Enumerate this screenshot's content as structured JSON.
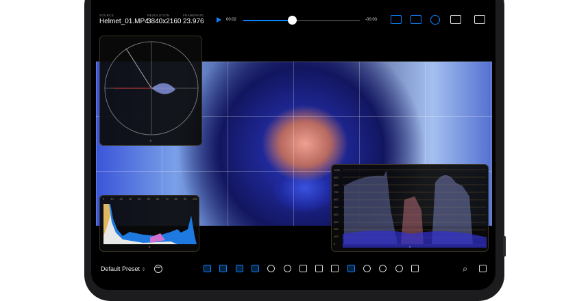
{
  "header": {
    "source_label": "SOURCE",
    "source_value": "Helmet_01.MP4",
    "resolution_label": "RESOLUTION",
    "resolution_value": "3840x2160",
    "framerate_label": "FRAMERATE",
    "framerate_value": "23.976",
    "time_elapsed": "00:02",
    "time_remaining": "-00:03",
    "playback_progress": 0.42,
    "icons": [
      "waveform-scope-icon",
      "parade-scope-icon",
      "vectorscope-icon",
      "grid-layout-icon",
      "sidebar-icon"
    ]
  },
  "scopes": {
    "histogram_ticks": [
      "0",
      "10",
      "20",
      "30",
      "40",
      "50",
      "60",
      "70",
      "80",
      "90",
      "100"
    ],
    "waveform_ticks": [
      "1000",
      "900",
      "800",
      "700",
      "600",
      "500",
      "400",
      "300",
      "200",
      "100",
      "0"
    ]
  },
  "toolbar": {
    "preset": "Default Preset",
    "tools": [
      "grid-icon",
      "safe-area-icon",
      "frame-icon",
      "layout-icon",
      "compare-icon",
      "zoom-fit-icon",
      "image-icon",
      "false-color-icon",
      "exposure-icon",
      "focus-peaking-icon",
      "timer-icon",
      "3d-lut-icon",
      "palette-icon",
      "record-icon"
    ]
  },
  "colors": {
    "accent": "#0a84ff"
  }
}
